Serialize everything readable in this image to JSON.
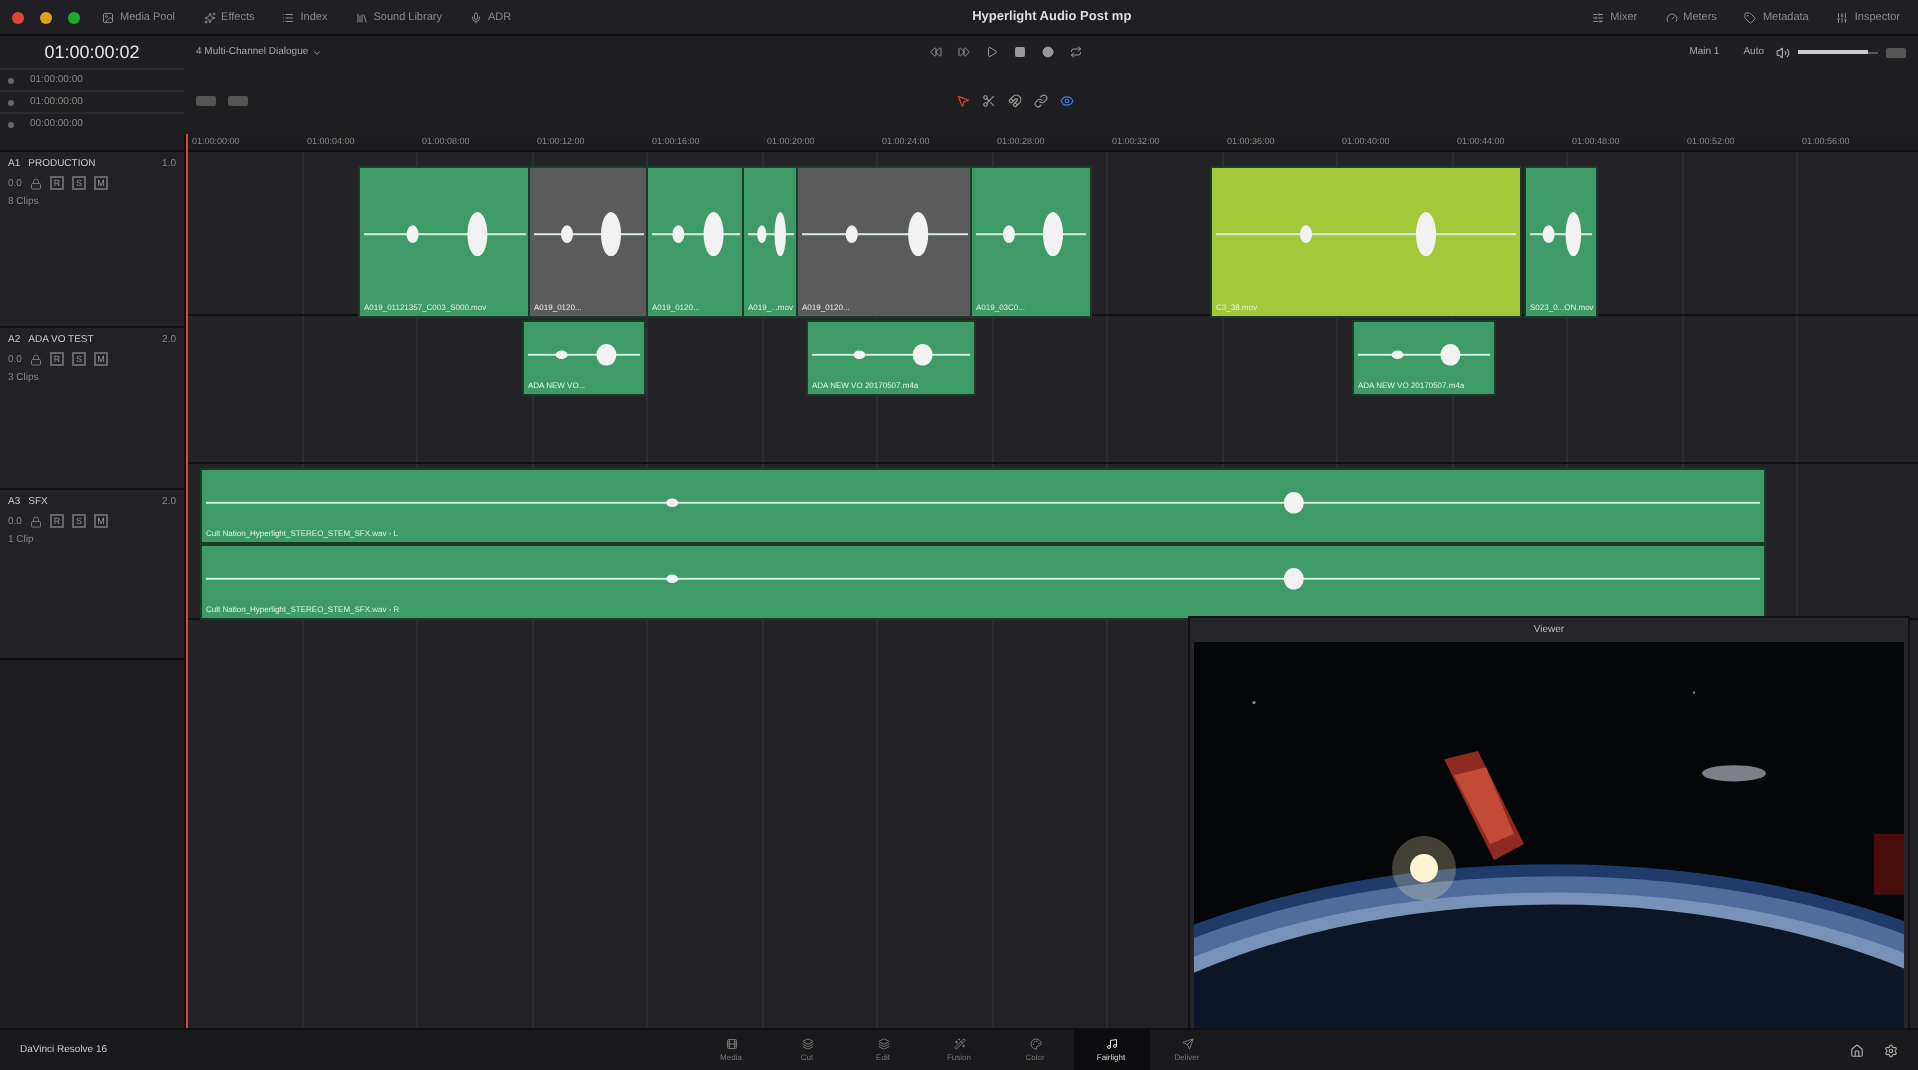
{
  "window": {
    "title": "Hyperlight Audio Post mp"
  },
  "top_tabs_left": [
    {
      "label": "Media Pool"
    },
    {
      "label": "Effects"
    },
    {
      "label": "Index"
    },
    {
      "label": "Sound Library"
    },
    {
      "label": "ADR"
    }
  ],
  "top_tabs_right": [
    {
      "label": "Mixer"
    },
    {
      "label": "Meters"
    },
    {
      "label": "Metadata"
    },
    {
      "label": "Inspector"
    }
  ],
  "timecode": "01:00:00:02",
  "timeline_name": "4 Multi-Channel Dialogue",
  "monitor": {
    "bus": "Main 1",
    "mode": "Auto",
    "level": 0.88
  },
  "timecodes": [
    "01:00:00:00",
    "01:00:00:00",
    "00:00:00:00"
  ],
  "ruler": [
    "01:00:00:00",
    "01:00:04:00",
    "01:00:08:00",
    "01:00:12:00",
    "01:00:16:00",
    "01:00:20:00",
    "01:00:24:00",
    "01:00:28:00",
    "01:00:32:00",
    "01:00:36:00",
    "01:00:40:00",
    "01:00:44:00",
    "01:00:48:00",
    "01:00:52:00",
    "01:00:56:00"
  ],
  "tracks": [
    {
      "number": "A1",
      "name": "PRODUCTION",
      "format": "1.0",
      "volume": "0.0",
      "buttons": [
        "R",
        "S",
        "M"
      ],
      "clip_count": "8 Clips",
      "clips": [
        {
          "name": "A019_01121357_C003_S000.mov",
          "color": "#3e9a66"
        },
        {
          "name": "A019_0120...",
          "color": "#5b5b5b"
        },
        {
          "name": "A019_0120...",
          "color": "#3e9a66"
        },
        {
          "name": "A019_...mov",
          "color": "#3e9a66"
        },
        {
          "name": "A019_0120...",
          "color": "#5b5b5b"
        },
        {
          "name": "A019_03C0...",
          "color": "#3e9a66"
        },
        {
          "name": "C3_38.mov",
          "color": "#a3c93a"
        },
        {
          "name": "S023_0...ON.mov",
          "color": "#3e9a66"
        }
      ]
    },
    {
      "number": "A2",
      "name": "ADA VO TEST",
      "format": "2.0",
      "volume": "0.0",
      "buttons": [
        "R",
        "S",
        "M"
      ],
      "clip_count": "3 Clips",
      "clips": [
        {
          "name": "ADA NEW VO...",
          "color": "#3e9a66"
        },
        {
          "name": "ADA NEW VO 20170507.m4a",
          "color": "#3e9a66"
        },
        {
          "name": "ADA NEW VO 20170507.m4a",
          "color": "#3e9a66"
        }
      ]
    },
    {
      "number": "A3",
      "name": "SFX",
      "format": "2.0",
      "volume": "0.0",
      "buttons": [
        "R",
        "S",
        "M"
      ],
      "clip_count": "1 Clip",
      "clips": [
        {
          "name": "Cult Nation_Hyperlight_STEREO_STEM_SFX.wav - L",
          "color": "#3e9a66"
        },
        {
          "name": "Cult Nation_Hyperlight_STEREO_STEM_SFX.wav - R",
          "color": "#3e9a66"
        }
      ]
    }
  ],
  "viewer": {
    "title": "Viewer"
  },
  "app_name": "DaVinci Resolve 16",
  "pages": [
    {
      "label": "Media",
      "selected": false
    },
    {
      "label": "Cut",
      "selected": false
    },
    {
      "label": "Edit",
      "selected": false
    },
    {
      "label": "Fusion",
      "selected": false
    },
    {
      "label": "Color",
      "selected": false
    },
    {
      "label": "Fairlight",
      "selected": true
    },
    {
      "label": "Deliver",
      "selected": false
    }
  ]
}
